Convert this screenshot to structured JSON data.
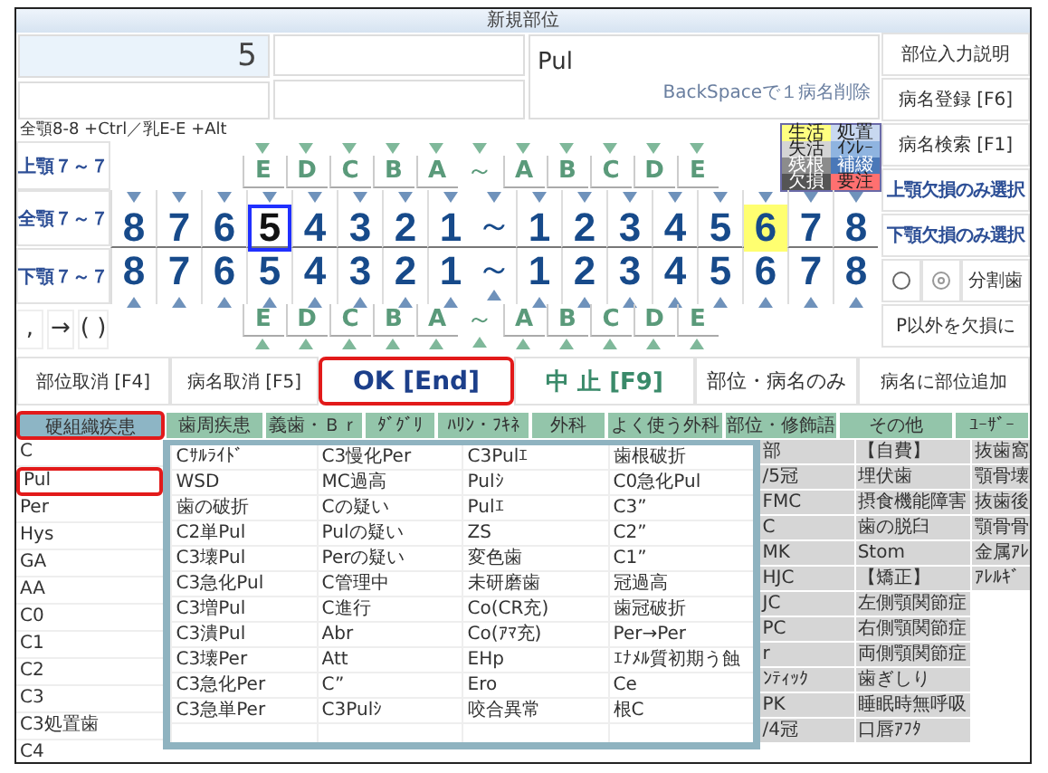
{
  "window": {
    "title": "新規部位"
  },
  "fields": {
    "site_number": "5",
    "disease": "Pul",
    "disease_hint": "BackSpaceで１病名削除"
  },
  "side_buttons": [
    {
      "label": "部位入力説明",
      "kind": "plain"
    },
    {
      "label": "病名登録 [F6]",
      "kind": "plain"
    },
    {
      "label": "病名検索 [F1]",
      "kind": "plain"
    },
    {
      "label": "上顎欠損のみ選択",
      "kind": "select"
    },
    {
      "label": "下顎欠損のみ選択",
      "kind": "select"
    }
  ],
  "radio_row": {
    "options": [
      {
        "selected": false
      },
      {
        "selected": true
      }
    ],
    "split_button": "分割歯"
  },
  "p_button": "P以外を欠損に",
  "chart": {
    "hint": "全顎8-8 +Ctrl／乳E-E +Alt",
    "jaw_buttons": [
      "上顎７～７",
      "全顎７～７",
      "下顎７～７"
    ],
    "symbol_buttons": [
      ",",
      "→",
      "( )"
    ],
    "legend": [
      {
        "label": "生活",
        "color": "#ffff80"
      },
      {
        "label": "処置",
        "color": "#c8d8f0"
      },
      {
        "label": "失活",
        "color": "#d4d4d4"
      },
      {
        "label": "ｲﾝﾚｰ",
        "color": "#8fb4e0"
      },
      {
        "label": "残根",
        "color": "#8c8c8c"
      },
      {
        "label": "補綴",
        "color": "#4a78b8"
      },
      {
        "label": "欠損",
        "color": "#555555"
      },
      {
        "label": "要注",
        "color": "#ff7070"
      }
    ],
    "rows": [
      {
        "kind": "deciduous",
        "right": [
          "E",
          "D",
          "C",
          "B",
          "A"
        ],
        "divider": "～",
        "left": [
          "A",
          "B",
          "C",
          "D",
          "E"
        ]
      },
      {
        "kind": "permanent",
        "divider": "～",
        "right": [
          {
            "label": "8",
            "selected": false,
            "highlighted": false
          },
          {
            "label": "7",
            "selected": false,
            "highlighted": false
          },
          {
            "label": "6",
            "selected": false,
            "highlighted": false
          },
          {
            "label": "5",
            "selected": true,
            "highlighted": false
          },
          {
            "label": "4",
            "selected": false,
            "highlighted": false
          },
          {
            "label": "3",
            "selected": false,
            "highlighted": false
          },
          {
            "label": "2",
            "selected": false,
            "highlighted": false
          },
          {
            "label": "1",
            "selected": false,
            "highlighted": false
          }
        ],
        "left": [
          {
            "label": "1",
            "selected": false,
            "highlighted": false
          },
          {
            "label": "2",
            "selected": false,
            "highlighted": false
          },
          {
            "label": "3",
            "selected": false,
            "highlighted": false
          },
          {
            "label": "4",
            "selected": false,
            "highlighted": false
          },
          {
            "label": "5",
            "selected": false,
            "highlighted": false
          },
          {
            "label": "6",
            "selected": false,
            "highlighted": true
          },
          {
            "label": "7",
            "selected": false,
            "highlighted": false
          },
          {
            "label": "8",
            "selected": false,
            "highlighted": false
          }
        ]
      },
      {
        "kind": "permanent",
        "divider": "～",
        "right": [
          {
            "label": "8",
            "selected": false,
            "highlighted": false
          },
          {
            "label": "7",
            "selected": false,
            "highlighted": false
          },
          {
            "label": "6",
            "selected": false,
            "highlighted": false
          },
          {
            "label": "5",
            "selected": false,
            "highlighted": false
          },
          {
            "label": "4",
            "selected": false,
            "highlighted": false
          },
          {
            "label": "3",
            "selected": false,
            "highlighted": false
          },
          {
            "label": "2",
            "selected": false,
            "highlighted": false
          },
          {
            "label": "1",
            "selected": false,
            "highlighted": false
          }
        ],
        "left": [
          {
            "label": "1",
            "selected": false,
            "highlighted": false
          },
          {
            "label": "2",
            "selected": false,
            "highlighted": false
          },
          {
            "label": "3",
            "selected": false,
            "highlighted": false
          },
          {
            "label": "4",
            "selected": false,
            "highlighted": false
          },
          {
            "label": "5",
            "selected": false,
            "highlighted": false
          },
          {
            "label": "6",
            "selected": false,
            "highlighted": false
          },
          {
            "label": "7",
            "selected": false,
            "highlighted": false
          },
          {
            "label": "8",
            "selected": false,
            "highlighted": false
          }
        ]
      },
      {
        "kind": "deciduous",
        "right": [
          "E",
          "D",
          "C",
          "B",
          "A"
        ],
        "divider": "～",
        "left": [
          "A",
          "B",
          "C",
          "D",
          "E"
        ]
      }
    ]
  },
  "action_buttons": [
    {
      "label": "部位取消 [F4]",
      "kind": "plain"
    },
    {
      "label": "病名取消 [F5]",
      "kind": "plain"
    },
    {
      "label": "OK [End]",
      "kind": "ok"
    },
    {
      "label": "中 止 [F9]",
      "kind": "cancel"
    },
    {
      "label": "部位・病名のみ",
      "kind": "plain"
    },
    {
      "label": "病名に部位追加",
      "kind": "plain"
    }
  ],
  "tabs": [
    {
      "label": "硬組織疾患",
      "selected": true
    },
    {
      "label": "歯周疾患",
      "selected": false
    },
    {
      "label": "義歯・Ｂｒ",
      "selected": false
    },
    {
      "label": "ﾀﾞｸﾞﾘ",
      "selected": false
    },
    {
      "label": "ﾊﾘﾝ・ﾌｷﾈ",
      "selected": false
    },
    {
      "label": "外科",
      "selected": false
    },
    {
      "label": "よく使う外科",
      "selected": false
    },
    {
      "label": "部位・修飾語",
      "selected": false
    },
    {
      "label": "その他",
      "selected": false
    },
    {
      "label": "ﾕｰｻﾞｰ",
      "selected": false
    }
  ],
  "category_list": [
    {
      "label": "C",
      "selected": false
    },
    {
      "label": "Pul",
      "selected": true
    },
    {
      "label": "Per",
      "selected": false
    },
    {
      "label": "Hys",
      "selected": false
    },
    {
      "label": "GA",
      "selected": false
    },
    {
      "label": "AA",
      "selected": false
    },
    {
      "label": "C0",
      "selected": false
    },
    {
      "label": "C1",
      "selected": false
    },
    {
      "label": "C2",
      "selected": false
    },
    {
      "label": "C3",
      "selected": false
    },
    {
      "label": "C3処置歯",
      "selected": false
    },
    {
      "label": "C4",
      "selected": false
    }
  ],
  "popup_columns": [
    [
      "Cｻﾙﾗｲﾄﾞ",
      "WSD",
      "歯の破折",
      "C2単Pul",
      "C3壊Pul",
      "C3急化Pul",
      "C3増Pul",
      "C3潰Pul",
      "C3壊Per",
      "C3急化Per",
      "C3急単Per"
    ],
    [
      "C3慢化Per",
      "MC過高",
      "Cの疑い",
      "Pulの疑い",
      "Perの疑い",
      "C管理中",
      "C進行",
      "Abr",
      "Att",
      "C”",
      "C3Pulｼ"
    ],
    [
      "C3Pulｴ",
      "Pulｼ",
      "Pulｴ",
      "ZS",
      "変色歯",
      "未研磨歯",
      "Co(CR充)",
      "Co(ｱﾏ充)",
      "EHp",
      "Ero",
      "咬合異常"
    ],
    [
      "歯根破折",
      "C0急化Pul",
      "C3”",
      "C2”",
      "C1”",
      "冠過高",
      "歯冠破折",
      "Per→Per",
      "ｴﾅﾒﾙ質初期う蝕",
      "Ce",
      "根C"
    ]
  ],
  "site_column": [
    "部",
    "/5冠",
    "FMC",
    "C",
    "MK",
    "HJC",
    "JC",
    "PC",
    "r",
    "ﾝﾃｨｯｸ",
    "PK",
    "/4冠"
  ],
  "other_column": [
    "【自費】",
    "埋伏歯",
    "摂食機能障害",
    "歯の脱臼",
    "Stom",
    "【矯正】",
    "左側顎関節症",
    "右側顎関節症",
    "両側顎関節症",
    "歯ぎしり",
    "睡眠時無呼吸",
    "口唇ｱﾌﾀ"
  ],
  "user_column": [
    "抜歯窩",
    "顎骨壊",
    "抜歯後",
    "顎骨骨",
    "金属ｱﾚ",
    "ｱﾚﾙｷﾞ"
  ]
}
